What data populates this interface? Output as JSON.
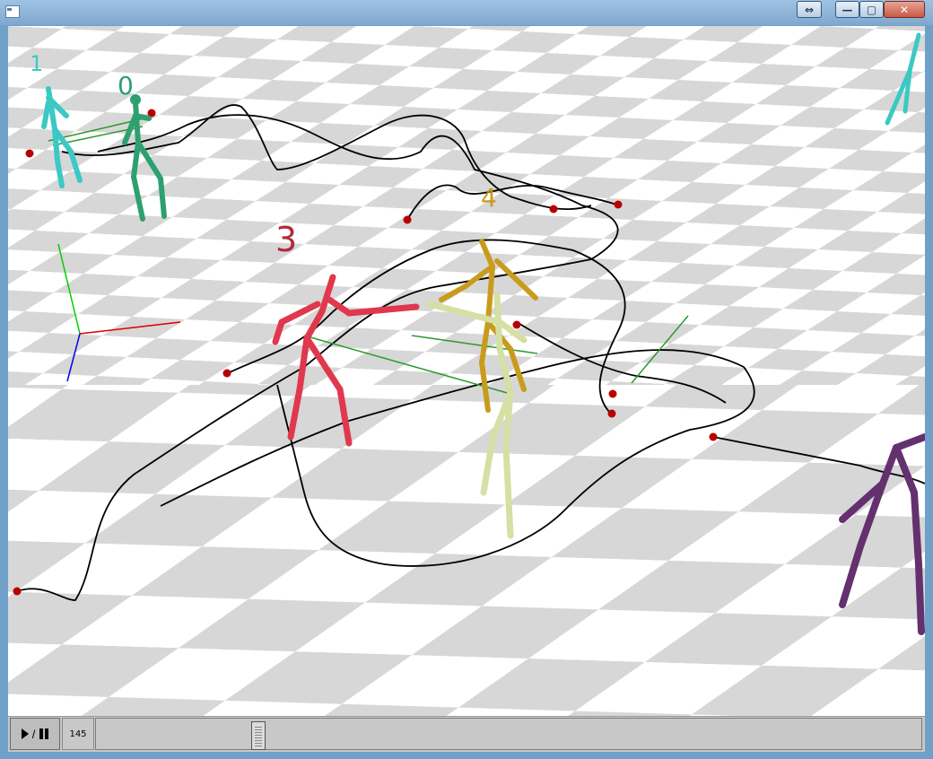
{
  "window": {
    "title": ""
  },
  "titlebar": {
    "extra_label": "⇔",
    "min_label": "—",
    "max_label": "▢",
    "close_label": "✕"
  },
  "scene": {
    "floor_color_light": "#ffffff",
    "floor_color_dark": "#d6d6d6",
    "trajectory_color": "#000000",
    "marker_color": "#b80000",
    "link_color": "#2a9a2a",
    "characters": [
      {
        "label": "0",
        "color": "#2ea070"
      },
      {
        "label": "1",
        "color": "#3bc9c5"
      },
      {
        "label": "3",
        "color": "#e0384d"
      },
      {
        "label": "4",
        "color": "#c99b1c"
      },
      {
        "label": "",
        "color": "#d6dfa4"
      },
      {
        "label": "",
        "color": "#64306e"
      }
    ]
  },
  "controls": {
    "play_pause_sep": "/",
    "frame": "145",
    "slider_fraction": 0.19
  }
}
